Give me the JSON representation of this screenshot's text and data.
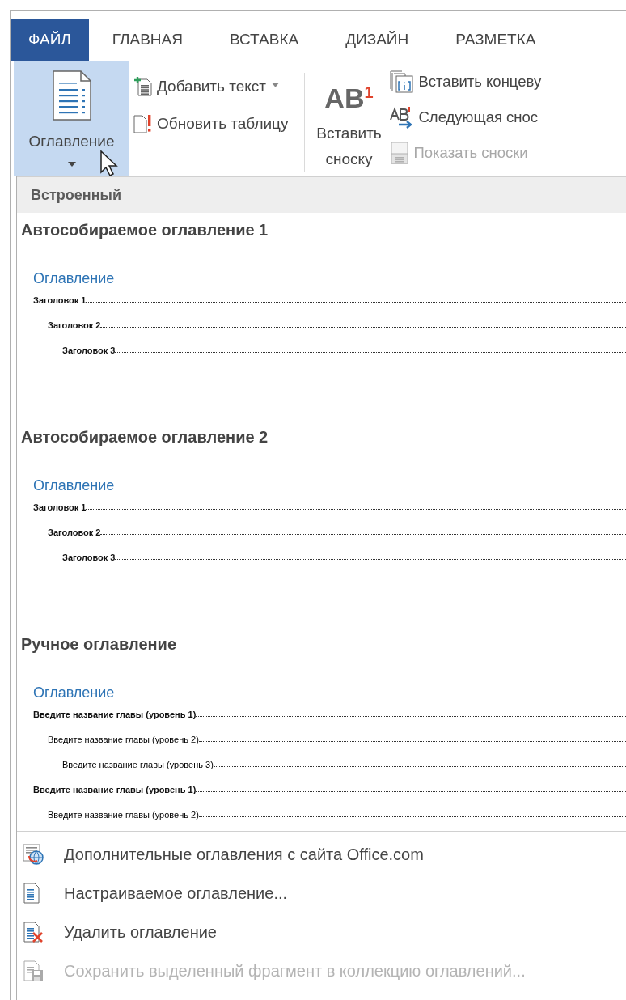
{
  "tabs": [
    {
      "label": "ФАЙЛ",
      "kind": "file"
    },
    {
      "label": "ГЛАВНАЯ",
      "kind": "tab"
    },
    {
      "label": "ВСТАВКА",
      "kind": "tab"
    },
    {
      "label": "ДИЗАЙН",
      "kind": "tab"
    },
    {
      "label": "РАЗМЕТКА",
      "kind": "tab"
    }
  ],
  "ribbon": {
    "toc_button": {
      "label": "Оглавление",
      "expanded": true
    },
    "toc_commands": [
      {
        "label": "Добавить текст",
        "dropdown": true
      },
      {
        "label": "Обновить таблицу",
        "dropdown": false
      }
    ],
    "footnote_button": {
      "icon_text": "AB",
      "icon_mark": "1",
      "label": "Вставить сноску"
    },
    "footnote_commands": [
      {
        "label": "Вставить концеву",
        "disabled": false
      },
      {
        "label": "Следующая снос",
        "disabled": false
      },
      {
        "label": "Показать сноски",
        "disabled": true
      }
    ]
  },
  "dropdown": {
    "section": "Встроенный",
    "galleries": [
      {
        "title": "Автособираемое оглавление 1",
        "kind": "auto",
        "preview": {
          "heading": "Оглавление",
          "entries": [
            {
              "text": "Заголовок 1",
              "children": [
                {
                  "text": "Заголовок 2",
                  "children": [
                    {
                      "text": "Заголовок 3"
                    }
                  ]
                }
              ]
            }
          ]
        }
      },
      {
        "title": "Автособираемое оглавление 2",
        "kind": "auto",
        "preview": {
          "heading": "Оглавление",
          "entries": [
            {
              "text": "Заголовок 1",
              "children": [
                {
                  "text": "Заголовок 2",
                  "children": [
                    {
                      "text": "Заголовок 3"
                    }
                  ]
                }
              ]
            }
          ]
        }
      },
      {
        "title": "Ручное оглавление",
        "kind": "manual",
        "preview": {
          "heading": "Оглавление",
          "entries": [
            {
              "text": "Введите название главы (уровень 1)",
              "children": [
                {
                  "text": "Введите название главы (уровень 2)",
                  "children": [
                    {
                      "text": "Введите название главы (уровень 3)"
                    }
                  ]
                }
              ]
            },
            {
              "text": "Введите название главы (уровень 1)",
              "children": [
                {
                  "text": "Введите название главы (уровень 2)"
                }
              ]
            }
          ]
        }
      }
    ],
    "menu": [
      {
        "label": "Дополнительные оглавления с сайта Office.com",
        "disabled": false
      },
      {
        "label": "Настраиваемое оглавление...",
        "disabled": false
      },
      {
        "label": "Удалить оглавление",
        "disabled": false
      },
      {
        "label": "Сохранить выделенный фрагмент в коллекцию оглавлений...",
        "disabled": true
      }
    ]
  }
}
